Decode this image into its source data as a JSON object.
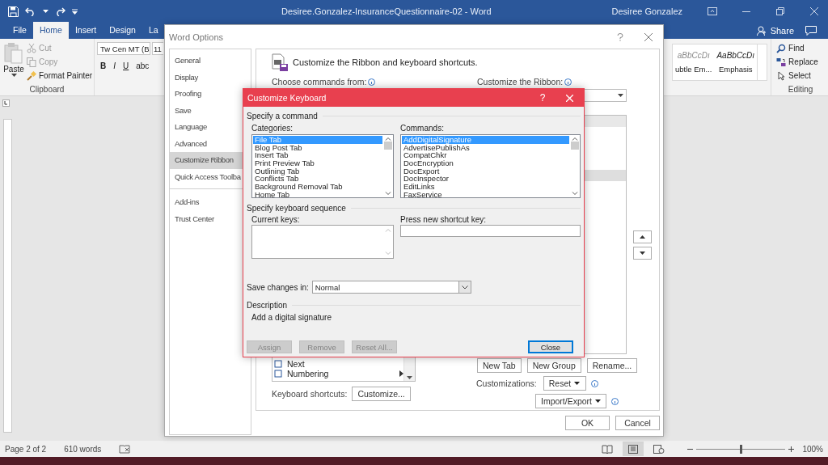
{
  "word_window": {
    "title": "Desiree.Gonzalez-InsuranceQuestionnaire-02  -  Word",
    "user": "Desiree Gonzalez"
  },
  "ribbon_tabs": [
    {
      "label": "File",
      "selected": false
    },
    {
      "label": "Home",
      "selected": true
    },
    {
      "label": "Insert",
      "selected": false
    },
    {
      "label": "Design",
      "selected": false
    },
    {
      "label": "La",
      "selected": false
    }
  ],
  "share": "Share",
  "clipboard": {
    "paste": "Paste",
    "items": [
      {
        "label": "Cut",
        "disabled": true
      },
      {
        "label": "Copy",
        "disabled": true
      },
      {
        "label": "Format Painter",
        "disabled": false
      }
    ],
    "group": "Clipboard"
  },
  "font": {
    "name": "Tw Cen MT (B",
    "size": "11",
    "buttons": [
      "B",
      "I",
      "U",
      "abc"
    ]
  },
  "styles": [
    {
      "sample": "aBbCcDı",
      "label": "ubtle Em..."
    },
    {
      "sample": "AaBbCcDı",
      "label": "Emphasis"
    }
  ],
  "editing": {
    "items": [
      {
        "kind": "find",
        "label": "Find"
      },
      {
        "kind": "replace",
        "label": "Replace"
      },
      {
        "kind": "select",
        "label": "Select"
      }
    ],
    "group": "Editing"
  },
  "status_bar": {
    "page": "Page 2 of 2",
    "words": "610 words",
    "views": [
      {
        "kind": "read",
        "selected": false
      },
      {
        "kind": "print",
        "selected": true
      },
      {
        "kind": "web",
        "selected": false
      }
    ],
    "zoom_slider": {
      "level": 0.5
    },
    "zoom": "100%"
  },
  "word_options": {
    "title": "Word Options",
    "nav_groups": [
      [
        {
          "label": "General",
          "selected": false
        },
        {
          "label": "Display",
          "selected": false
        },
        {
          "label": "Proofing",
          "selected": false
        },
        {
          "label": "Save",
          "selected": false
        },
        {
          "label": "Language",
          "selected": false
        },
        {
          "label": "Advanced",
          "selected": false
        },
        {
          "label": "Customize Ribbon",
          "selected": true
        },
        {
          "label": "Quick Access Toolba",
          "selected": false
        }
      ],
      [
        {
          "label": "Add-ins",
          "selected": false
        },
        {
          "label": "Trust Center",
          "selected": false
        }
      ]
    ],
    "header": "Customize the Ribbon and keyboard shortcuts.",
    "choose_label": "Choose commands from:",
    "ribbon_label": "Customize the Ribbon:",
    "commands": [
      "Next",
      "Numbering"
    ],
    "tab_buttons": [
      "New Tab",
      "New Group",
      "Rename..."
    ],
    "customizations_label": "Customizations:",
    "reset": "Reset",
    "import_export": "Import/Export",
    "keyboard_label": "Keyboard shortcuts:",
    "customize": "Customize...",
    "ok": "OK",
    "cancel": "Cancel"
  },
  "customize_keyboard": {
    "title": "Customize Keyboard",
    "help": "?",
    "command_section": "Specify a command",
    "categories_label": "Categories:",
    "categories": [
      {
        "label": "File Tab",
        "selected": true
      },
      {
        "label": "Blog Post Tab",
        "selected": false
      },
      {
        "label": "Insert Tab",
        "selected": false
      },
      {
        "label": "Print Preview Tab",
        "selected": false
      },
      {
        "label": "Outlining Tab",
        "selected": false
      },
      {
        "label": "Conflicts Tab",
        "selected": false
      },
      {
        "label": "Background Removal Tab",
        "selected": false
      },
      {
        "label": "Home Tab",
        "selected": false
      }
    ],
    "commands_label": "Commands:",
    "commands": [
      {
        "label": "AddDigitalSignature",
        "selected": true
      },
      {
        "label": "AdvertisePublishAs",
        "selected": false
      },
      {
        "label": "CompatChkr",
        "selected": false
      },
      {
        "label": "DocEncryption",
        "selected": false
      },
      {
        "label": "DocExport",
        "selected": false
      },
      {
        "label": "DocInspector",
        "selected": false
      },
      {
        "label": "EditLinks",
        "selected": false
      },
      {
        "label": "FaxService",
        "selected": false
      }
    ],
    "sequence_section": "Specify keyboard sequence",
    "current_keys_label": "Current keys:",
    "new_key_label": "Press new shortcut key:",
    "save_label": "Save changes in:",
    "save_value": "Normal",
    "description_section": "Description",
    "description": "Add a digital signature",
    "buttons": [
      {
        "label": "Assign",
        "disabled": true,
        "default": false
      },
      {
        "label": "Remove",
        "disabled": true,
        "default": false
      },
      {
        "label": "Reset All...",
        "disabled": true,
        "default": false
      },
      {
        "label": "Close",
        "disabled": false,
        "default": true
      }
    ]
  }
}
